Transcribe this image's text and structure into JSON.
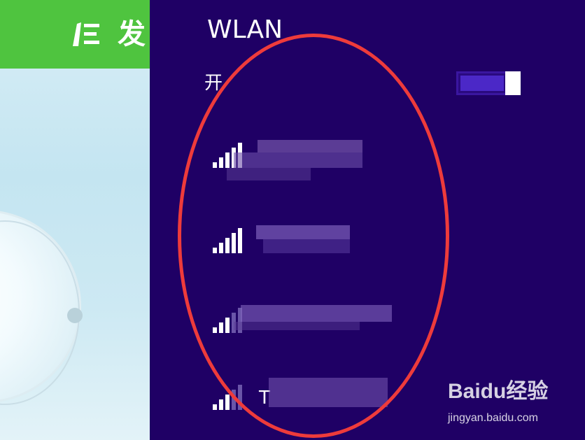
{
  "background_app": {
    "title": "发"
  },
  "wlan_panel": {
    "title": "WLAN",
    "wifi_toggle": {
      "label": "开",
      "state": "on"
    },
    "networks": [
      {
        "name": "",
        "signal_level": 5,
        "signal_max": 5
      },
      {
        "name": "",
        "signal_level": 5,
        "signal_max": 5
      },
      {
        "name": "",
        "signal_level": 3,
        "signal_max": 5
      },
      {
        "name": "T",
        "signal_level": 3,
        "signal_max": 5
      }
    ]
  },
  "watermark": {
    "logo": "Baidu经验",
    "url": "jingyan.baidu.com"
  },
  "colors": {
    "panel_bg": "#1f0065",
    "header_green": "#4fc43f",
    "toggle_accent": "#4b28c7",
    "annotation_red": "#ee3b3b"
  },
  "icons": [
    "pencil-icon",
    "signal-icon",
    "baidu-paw-icon"
  ]
}
